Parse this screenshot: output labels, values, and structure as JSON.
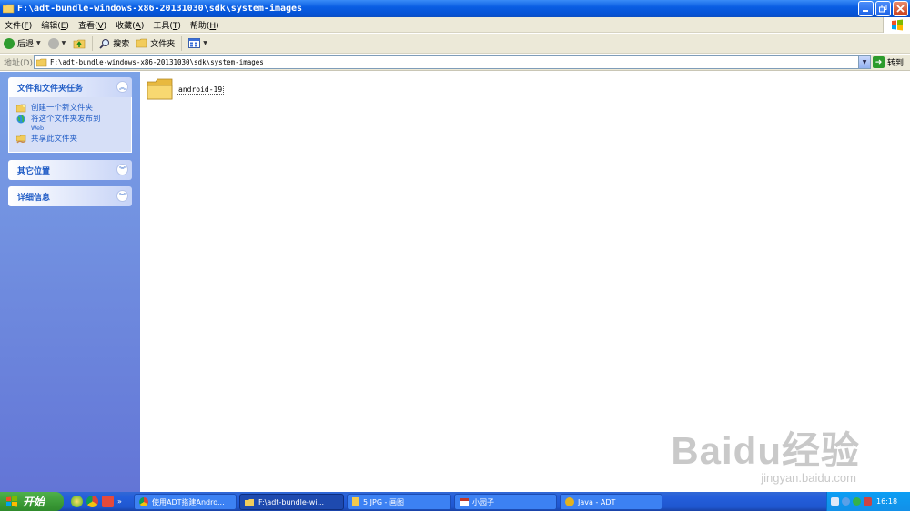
{
  "window": {
    "title": "F:\\adt-bundle-windows-x86-20131030\\sdk\\system-images"
  },
  "menu": [
    {
      "label": "文件(",
      "key": "F",
      "end": ")"
    },
    {
      "label": "编辑(",
      "key": "E",
      "end": ")"
    },
    {
      "label": "查看(",
      "key": "V",
      "end": ")"
    },
    {
      "label": "收藏(",
      "key": "A",
      "end": ")"
    },
    {
      "label": "工具(",
      "key": "T",
      "end": ")"
    },
    {
      "label": "帮助(",
      "key": "H",
      "end": ")"
    }
  ],
  "toolbar": {
    "back_label": "后退",
    "search_label": "搜索",
    "folders_label": "文件夹"
  },
  "address": {
    "label": "地址(D)",
    "value": "F:\\adt-bundle-windows-x86-20131030\\sdk\\system-images",
    "go_label": "转到"
  },
  "tasks_panel": {
    "title": "文件和文件夹任务",
    "items": [
      {
        "label": "创建一个新文件夹"
      },
      {
        "label": "将这个文件夹发布到",
        "sub": "Web"
      },
      {
        "label": "共享此文件夹"
      }
    ]
  },
  "other_places_panel": {
    "title": "其它位置"
  },
  "details_panel": {
    "title": "详细信息"
  },
  "content": {
    "items": [
      {
        "name": "android-19"
      }
    ]
  },
  "watermark": {
    "main": "Baidu经验",
    "sub": "jingyan.baidu.com"
  },
  "taskbar": {
    "start_label": "开始",
    "buttons": [
      {
        "label": "使用ADT搭建Andro..."
      },
      {
        "label": "F:\\adt-bundle-wi..."
      },
      {
        "label": "5.JPG - 画图"
      },
      {
        "label": "小园子"
      },
      {
        "label": "Java - ADT"
      }
    ],
    "clock": "16:18"
  },
  "colors": {
    "titlebar": "#0a5ee3",
    "task_pane": "#7ba2e7",
    "taskbar": "#245edb",
    "start": "#3a9a36"
  }
}
